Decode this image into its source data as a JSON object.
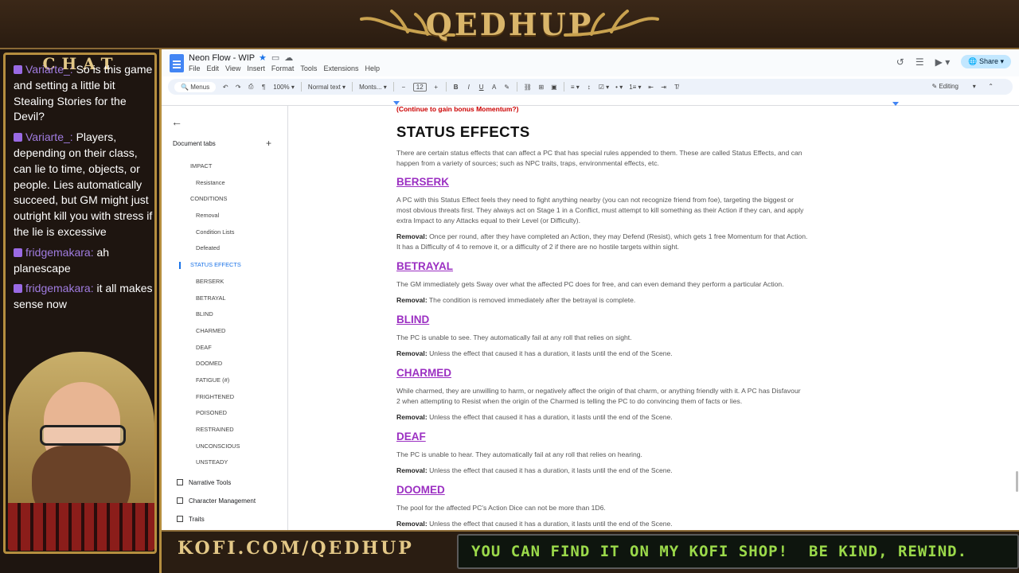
{
  "overlay": {
    "brand": "QEDHUP",
    "chat_title": "CHAT",
    "kofi": "KOFI.COM/QEDHUP",
    "ticker_left": "YOU CAN FIND IT ON MY KOFI SHOP!",
    "ticker_right": "BE KIND, REWIND.",
    "chat_lines": [
      {
        "user": "Variarte_:",
        "text": "So is this game and setting a little bit Stealing Stories for the Devil?"
      },
      {
        "user": "Variarte_:",
        "text": "Players, depending on their class, can lie to time, objects, or people. Lies automatically succeed, but GM might just outright kill you with stress if the lie is excessive"
      },
      {
        "user": "fridgemakara:",
        "text": "ah planescape"
      },
      {
        "user": "fridgemakara:",
        "text": "it all makes sense now"
      }
    ]
  },
  "docs": {
    "title": "Neon Flow - WIP",
    "menu": [
      "File",
      "Edit",
      "View",
      "Insert",
      "Format",
      "Tools",
      "Extensions",
      "Help"
    ],
    "share_label": "Share",
    "toolbar": {
      "search": "Menus",
      "zoom": "100%",
      "style": "Normal text",
      "font": "Monts...",
      "font_size": "12",
      "mode": "Editing"
    },
    "sidebar": {
      "header": "Document tabs",
      "items": [
        {
          "label": "IMPACT",
          "level": 1
        },
        {
          "label": "Resistance",
          "level": 2
        },
        {
          "label": "CONDITIONS",
          "level": 1
        },
        {
          "label": "Removal",
          "level": 2
        },
        {
          "label": "Condition Lists",
          "level": 2
        },
        {
          "label": "Defeated",
          "level": 2
        },
        {
          "label": "STATUS EFFECTS",
          "level": 1,
          "active": true
        },
        {
          "label": "BERSERK",
          "level": 2
        },
        {
          "label": "BETRAYAL",
          "level": 2
        },
        {
          "label": "BLIND",
          "level": 2
        },
        {
          "label": "CHARMED",
          "level": 2
        },
        {
          "label": "DEAF",
          "level": 2
        },
        {
          "label": "DOOMED",
          "level": 2
        },
        {
          "label": "FATIGUE (#)",
          "level": 2
        },
        {
          "label": "FRIGHTENED",
          "level": 2
        },
        {
          "label": "POISONED",
          "level": 2
        },
        {
          "label": "RESTRAINED",
          "level": 2
        },
        {
          "label": "UNCONSCIOUS",
          "level": 2
        },
        {
          "label": "UNSTEADY",
          "level": 2
        }
      ],
      "tabs": [
        "Narrative Tools",
        "Character Management",
        "Traits"
      ]
    },
    "content": {
      "top_note": "(Continue to gain bonus Momentum?)",
      "heading": "STATUS EFFECTS",
      "intro_1": "There are certain status effects that can affect a PC that has special rules appended to them. These are called Status Effects, and can",
      "intro_2": "happen from a variety of sources; such as NPC traits, traps, environmental effects, etc.",
      "removal_label": "Removal:",
      "sections": [
        {
          "title": "BERSERK",
          "body": [
            "A PC with this Status Effect feels they need to fight anything nearby (you can not recognize friend from foe), targeting the biggest or",
            "most obvious threats first. They always act on Stage 1 in a Conflict, must attempt to kill something as their Action if they can, and apply",
            "extra Impact to any Attacks equal to their Level (or Difficulty)."
          ],
          "removal": [
            "Once per round, after they have completed an Action, they may Defend (Resist), which gets 1 free Momentum for that Action.",
            "It has a Difficulty of 4 to remove it, or a difficulty of 2 if there are no hostile targets within sight."
          ]
        },
        {
          "title": "BETRAYAL",
          "body": [
            "The GM immediately gets Sway over what the affected PC does for free, and can even demand they perform a particular Action."
          ],
          "removal": [
            "The condition is removed immediately after the betrayal is complete."
          ]
        },
        {
          "title": "BLIND",
          "body": [
            "The PC is unable to see. They automatically fail at any roll that relies on sight."
          ],
          "removal": [
            "Unless the effect that caused it has a duration, it lasts until the end of the Scene."
          ]
        },
        {
          "title": "CHARMED",
          "body": [
            "While charmed, they are unwilling to harm, or negatively affect the origin of that charm, or anything friendly with it. A PC has Disfavour",
            "2 when attempting to Resist when the origin of the Charmed is telling the PC to do convincing them of facts or lies."
          ],
          "removal": [
            "Unless the effect that caused it has a duration, it lasts until the end of the Scene."
          ]
        },
        {
          "title": "DEAF",
          "body": [
            "The PC is unable to hear. They automatically fail at any roll that relies on hearing."
          ],
          "removal": [
            "Unless the effect that caused it has a duration, it lasts until the end of the Scene."
          ]
        },
        {
          "title": "DOOMED",
          "body": [
            "The pool for the affected PC's Action Dice can not be more than 1D6."
          ],
          "removal": [
            "Unless the effect that caused it has a duration, it lasts until the end of the Scene."
          ]
        }
      ]
    }
  }
}
